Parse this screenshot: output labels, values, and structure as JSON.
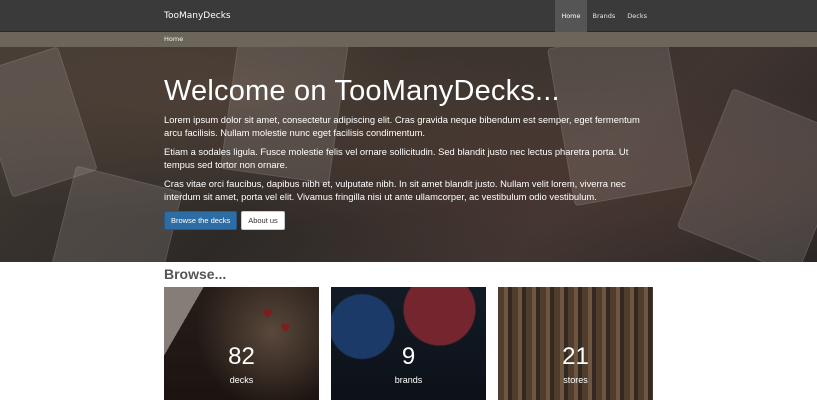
{
  "navbar": {
    "brand": "TooManyDecks",
    "items": [
      {
        "label": "Home",
        "active": true
      },
      {
        "label": "Brands",
        "active": false
      },
      {
        "label": "Decks",
        "active": false
      }
    ]
  },
  "breadcrumb": {
    "items": [
      "Home"
    ]
  },
  "hero": {
    "title": "Welcome on TooManyDecks...",
    "paragraphs": [
      "Lorem ipsum dolor sit amet, consectetur adipiscing elit. Cras gravida neque bibendum est semper, eget fermentum arcu facilisis. Nullam molestie nunc eget facilisis condimentum.",
      "Etiam a sodales ligula. Fusce molestie felis vel ornare sollicitudin. Sed blandit justo nec lectus pharetra porta. Ut tempus sed tortor non ornare.",
      "Cras vitae orci faucibus, dapibus nibh et, vulputate nibh. In sit amet blandit justo. Nullam velit lorem, viverra nec interdum sit amet, porta vel elit. Vivamus fringilla nisi ut ante ullamcorper, ac vestibulum odio vestibulum."
    ],
    "buttons": {
      "primary": "Browse the decks",
      "secondary": "About us"
    }
  },
  "browse": {
    "title": "Browse...",
    "tiles": [
      {
        "count": "82",
        "label": "decks"
      },
      {
        "count": "9",
        "label": "brands"
      },
      {
        "count": "21",
        "label": "stores"
      }
    ]
  },
  "colors": {
    "navbar": "#3a3a3a",
    "breadcrumb_bar": "#6b655a",
    "primary_button": "#2e6da4"
  }
}
